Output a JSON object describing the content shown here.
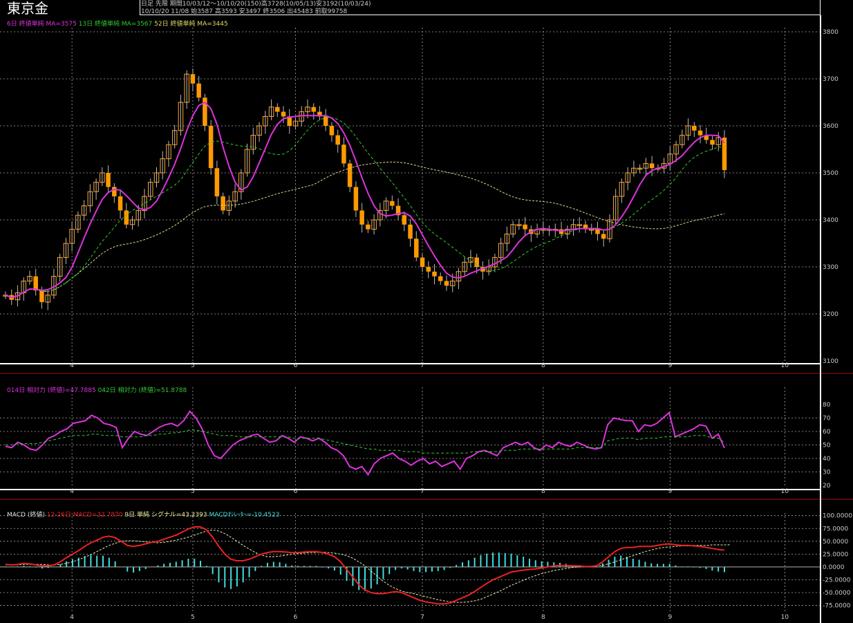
{
  "window": {
    "title": "東京金",
    "header_line1": "日足 先限 期間10/03/12〜10/10/20(150)高3728(10/05/13)安3192(10/03/24)",
    "header_line2": "10/10/20 11/08 始3587 高3593 安3497 終3506 出45483 前取99758"
  },
  "legend": {
    "price_ma6": "6日 終値単純 MA=3575",
    "price_ma13": "13日 終値単純 MA=3567",
    "price_ma52": "52日 終値単純 MA=3445",
    "rsi14": "014日 相対力 (終値)=47.7885",
    "rsi42": "042日 相対力 (終値)=51.8788",
    "macd_name": "MACD (終値)",
    "macd_line": "12-26日 MACD=32.7870",
    "macd_signal": "9日 単純 シグナル=43.2393",
    "macd_osc": "MACDｵｼﾚｰﾀｰ=-10.4523"
  },
  "colors": {
    "candle": "#ff9900",
    "ma6": "#dd33dd",
    "ma13": "#33cc33",
    "ma52": "#dddd88",
    "rsi14": "#dd33dd",
    "rsi42": "#33cc33",
    "macd": "#ee2222",
    "signal": "#eeeebb",
    "osc": "#44dddd",
    "grid": "#aaaaaa"
  },
  "chart_data": [
    {
      "type": "candlestick",
      "title": "東京金",
      "x_month_labels": [
        {
          "label": "4",
          "index": 11
        },
        {
          "label": "5",
          "index": 31
        },
        {
          "label": "6",
          "index": 48
        },
        {
          "label": "7",
          "index": 69
        },
        {
          "label": "8",
          "index": 89
        },
        {
          "label": "9",
          "index": 110
        },
        {
          "label": "10",
          "index": 129
        }
      ],
      "ylim": [
        3100,
        3830
      ],
      "y_ticks": [
        3100,
        3200,
        3300,
        3400,
        3500,
        3600,
        3700,
        3800
      ],
      "grid": true,
      "ohlc_close": [
        3240,
        3230,
        3245,
        3270,
        3280,
        3250,
        3225,
        3240,
        3280,
        3320,
        3350,
        3380,
        3410,
        3430,
        3460,
        3480,
        3500,
        3470,
        3450,
        3420,
        3390,
        3400,
        3420,
        3450,
        3480,
        3500,
        3530,
        3560,
        3590,
        3650,
        3710,
        3690,
        3660,
        3600,
        3510,
        3450,
        3420,
        3440,
        3460,
        3500,
        3550,
        3580,
        3600,
        3620,
        3640,
        3630,
        3620,
        3600,
        3610,
        3630,
        3640,
        3630,
        3620,
        3600,
        3580,
        3560,
        3520,
        3470,
        3420,
        3390,
        3380,
        3400,
        3420,
        3440,
        3430,
        3410,
        3390,
        3360,
        3320,
        3300,
        3290,
        3280,
        3270,
        3260,
        3270,
        3290,
        3310,
        3320,
        3300,
        3290,
        3300,
        3320,
        3350,
        3370,
        3390,
        3390,
        3380,
        3370,
        3380,
        3380,
        3380,
        3380,
        3370,
        3380,
        3390,
        3390,
        3380,
        3380,
        3370,
        3360,
        3400,
        3450,
        3480,
        3500,
        3510,
        3510,
        3520,
        3510,
        3510,
        3520,
        3540,
        3560,
        3580,
        3600,
        3590,
        3580,
        3570,
        3560,
        3575,
        3506
      ],
      "ma_series": [
        {
          "name": "6日 終値単純",
          "color_key": "ma6"
        },
        {
          "name": "13日 終値単純",
          "color_key": "ma13"
        },
        {
          "name": "52日 終値単純",
          "color_key": "ma52"
        }
      ],
      "last_values": {
        "ma6": 3575,
        "ma13": 3567,
        "ma52": 3445,
        "open": 3587,
        "high": 3593,
        "low": 3497,
        "close": 3506
      }
    },
    {
      "type": "line",
      "title": "相対力",
      "ylim": [
        20,
        80
      ],
      "y_ticks": [
        20,
        30,
        40,
        50,
        60,
        70,
        80
      ],
      "series": [
        {
          "name": "014日 相対力 (終値)",
          "last": 47.7885,
          "values": [
            49,
            48,
            52,
            50,
            47,
            46,
            50,
            55,
            57,
            60,
            62,
            66,
            67,
            68,
            72,
            70,
            66,
            65,
            63,
            48,
            55,
            60,
            58,
            57,
            60,
            63,
            65,
            66,
            64,
            68,
            75,
            70,
            62,
            50,
            42,
            40,
            45,
            50,
            53,
            55,
            57,
            58,
            55,
            52,
            53,
            57,
            55,
            52,
            56,
            55,
            53,
            55,
            52,
            48,
            46,
            42,
            34,
            32,
            34,
            28,
            36,
            40,
            42,
            44,
            40,
            38,
            35,
            38,
            40,
            36,
            38,
            34,
            36,
            38,
            32,
            40,
            42,
            45,
            46,
            44,
            42,
            48,
            50,
            52,
            50,
            52,
            48,
            46,
            50,
            48,
            52,
            50,
            49,
            52,
            50,
            48,
            47,
            48,
            65,
            70,
            69,
            68,
            68,
            60,
            65,
            64,
            66,
            70,
            74,
            56,
            58,
            60,
            62,
            65,
            64,
            55,
            58,
            47.7885
          ]
        },
        {
          "name": "042日 相対力 (終値)",
          "last": 51.8788,
          "values": [
            50,
            50,
            51,
            51,
            51,
            51,
            52,
            53,
            54,
            55,
            56,
            57,
            57,
            57,
            58,
            58,
            57,
            57,
            57,
            56,
            56,
            56,
            56,
            57,
            57,
            58,
            58,
            59,
            59,
            60,
            61,
            61,
            60,
            59,
            58,
            57,
            57,
            57,
            56,
            56,
            56,
            56,
            56,
            56,
            56,
            56,
            56,
            55,
            55,
            55,
            55,
            55,
            54,
            53,
            52,
            51,
            50,
            49,
            48,
            47,
            47,
            46,
            46,
            46,
            46,
            45,
            45,
            45,
            44,
            44,
            44,
            44,
            44,
            44,
            44,
            44,
            45,
            45,
            45,
            45,
            45,
            46,
            46,
            46,
            47,
            47,
            47,
            47,
            47,
            47,
            47,
            47,
            47,
            48,
            48,
            48,
            48,
            48,
            53,
            54,
            55,
            55,
            55,
            54,
            55,
            55,
            55,
            56,
            56,
            56,
            56,
            56,
            57,
            57,
            57,
            55,
            55,
            51.8788
          ]
        }
      ]
    },
    {
      "type": "line",
      "title": "MACD (終値)",
      "ylim": [
        -85,
        105
      ],
      "y_ticks": [
        -75,
        -50,
        -25,
        0,
        25,
        50,
        75,
        100
      ],
      "y_tick_labels": [
        "-75.0000",
        "-50.0000",
        "-25.0000",
        "0.0000",
        "25.0000",
        "50.0000",
        "75.0000",
        "100.0000"
      ],
      "series": [
        {
          "name": "12-26日 MACD",
          "last": 32.787,
          "values": [
            5,
            4,
            5,
            7,
            6,
            4,
            2,
            2,
            4,
            10,
            18,
            25,
            32,
            40,
            47,
            52,
            58,
            60,
            57,
            50,
            42,
            40,
            42,
            45,
            48,
            50,
            54,
            58,
            62,
            68,
            74,
            78,
            78,
            72,
            58,
            40,
            25,
            15,
            12,
            12,
            15,
            20,
            25,
            28,
            30,
            30,
            29,
            28,
            28,
            29,
            30,
            30,
            28,
            25,
            20,
            10,
            -5,
            -20,
            -35,
            -45,
            -50,
            -52,
            -52,
            -50,
            -48,
            -50,
            -55,
            -60,
            -65,
            -68,
            -70,
            -72,
            -72,
            -70,
            -65,
            -60,
            -55,
            -48,
            -40,
            -32,
            -25,
            -20,
            -15,
            -10,
            -8,
            -6,
            -5,
            -4,
            -2,
            0,
            2,
            3,
            3,
            2,
            2,
            1,
            1,
            2,
            10,
            20,
            30,
            36,
            38,
            38,
            40,
            40,
            40,
            42,
            44,
            45,
            43,
            42,
            42,
            41,
            40,
            38,
            36,
            34,
            32.787
          ]
        },
        {
          "name": "9日 単純 シグナル",
          "last": 43.2393,
          "values": [
            4,
            4,
            4,
            5,
            5,
            5,
            5,
            4,
            4,
            5,
            7,
            10,
            14,
            19,
            24,
            30,
            36,
            42,
            46,
            50,
            51,
            51,
            50,
            49,
            48,
            47,
            48,
            50,
            52,
            55,
            58,
            62,
            66,
            70,
            72,
            70,
            65,
            58,
            50,
            42,
            35,
            28,
            23,
            20,
            20,
            21,
            23,
            25,
            26,
            27,
            28,
            28,
            29,
            28,
            27,
            25,
            22,
            17,
            10,
            2,
            -8,
            -18,
            -28,
            -36,
            -42,
            -47,
            -50,
            -52,
            -55,
            -58,
            -61,
            -64,
            -66,
            -68,
            -69,
            -69,
            -68,
            -66,
            -63,
            -58,
            -53,
            -48,
            -42,
            -36,
            -31,
            -26,
            -21,
            -17,
            -13,
            -10,
            -7,
            -5,
            -3,
            -1,
            0,
            1,
            1,
            2,
            3,
            6,
            10,
            14,
            18,
            22,
            26,
            30,
            33,
            36,
            38,
            39,
            40,
            41,
            41,
            42,
            42,
            42,
            43,
            43,
            43,
            43.2393
          ]
        }
      ],
      "oscillator": {
        "name": "MACDｵｼﾚｰﾀｰ",
        "last": -10.4523
      }
    }
  ]
}
